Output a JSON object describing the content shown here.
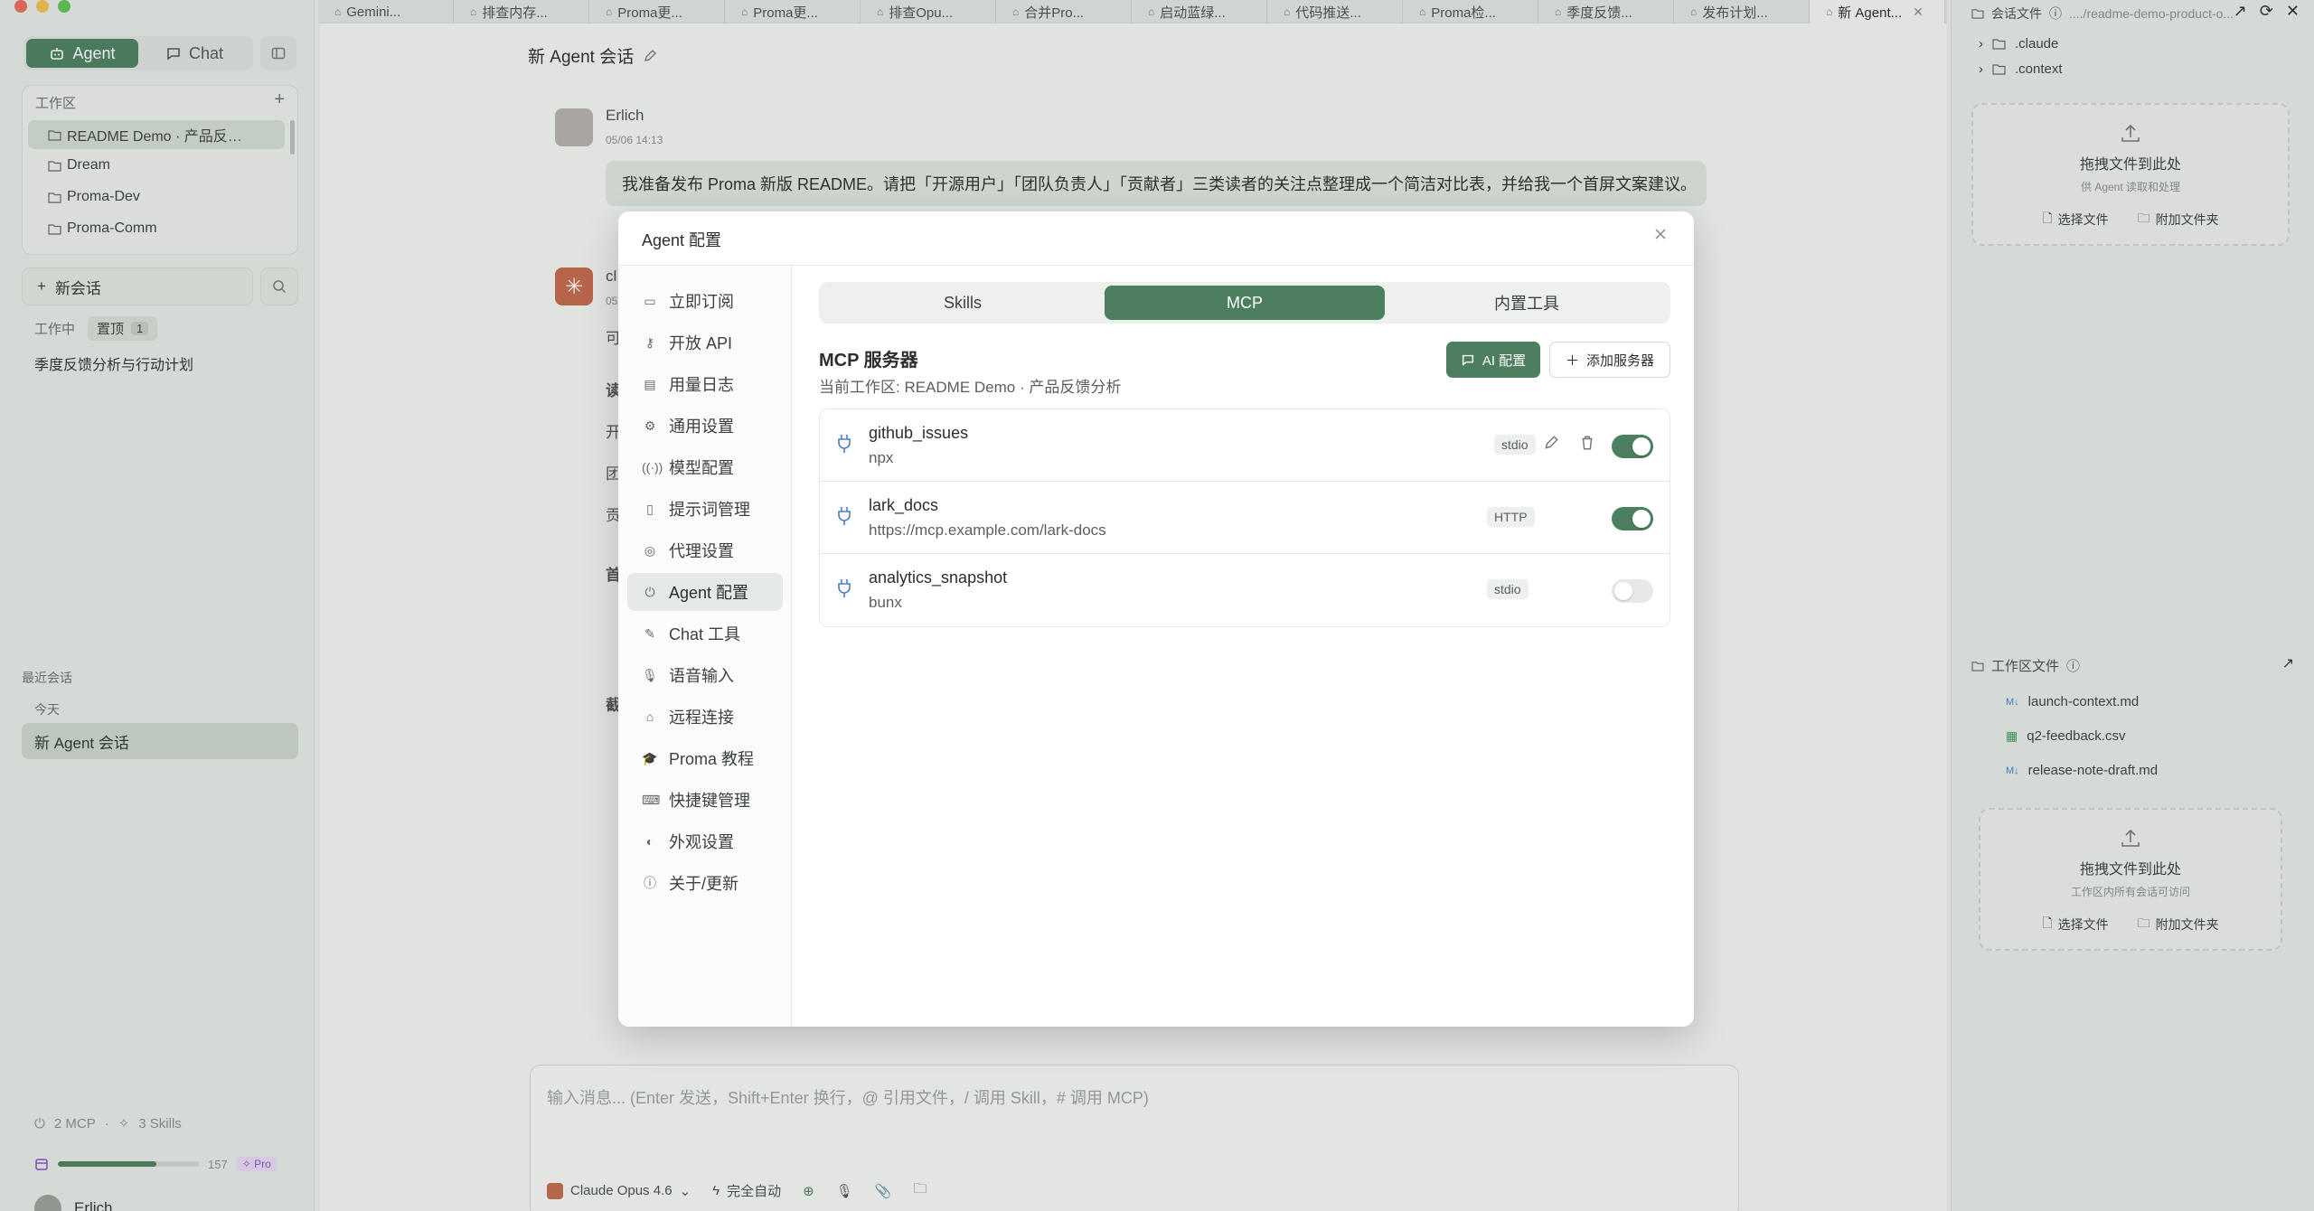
{
  "sidebar": {
    "mode_tabs": {
      "agent": "Agent",
      "chat": "Chat"
    },
    "workspace": {
      "title": "工作区",
      "items": [
        "README Demo · 产品反…",
        "Dream",
        "Proma-Dev",
        "Proma-Comm"
      ]
    },
    "new_chat": "新会话",
    "tags": {
      "working": "工作中",
      "pinned": "置顶",
      "pinned_count": "1"
    },
    "pinned_items": [
      "季度反馈分析与行动计划"
    ],
    "recent_label": "最近会话",
    "today_label": "今天",
    "recent_items": [
      "新 Agent 会话"
    ],
    "stats": {
      "mcp": "2 MCP",
      "skills": "3 Skills"
    },
    "usage": {
      "value": "157",
      "fill_percent": 70,
      "plan": "Pro"
    },
    "user": {
      "name": "Erlich"
    }
  },
  "tabs": [
    {
      "label": "Gemini...",
      "active": false
    },
    {
      "label": "排查内存...",
      "active": false
    },
    {
      "label": "Proma更...",
      "active": false
    },
    {
      "label": "Proma更...",
      "active": false
    },
    {
      "label": "排查Opu...",
      "active": false
    },
    {
      "label": "合并Pro...",
      "active": false
    },
    {
      "label": "启动蓝绿...",
      "active": false
    },
    {
      "label": "代码推送...",
      "active": false
    },
    {
      "label": "Proma检...",
      "active": false
    },
    {
      "label": "季度反馈...",
      "active": false
    },
    {
      "label": "发布计划...",
      "active": false
    },
    {
      "label": "新 Agent...",
      "active": true
    }
  ],
  "chat": {
    "title": "新 Agent 会话",
    "user_name": "Erlich",
    "user_time": "05/06 14:13",
    "user_message": "我准备发布 Proma 新版 README。请把「开源用户」「团队负责人」「贡献者」三类读者的关注点整理成一个简洁对比表，并给我一个首屏文案建议。",
    "ai_name_partial": "cl",
    "ai_time_partial": "05",
    "partial_lines": [
      "可",
      "读",
      "开",
      "团",
      "贡",
      "首",
      "截"
    ],
    "composer_placeholder": "输入消息... (Enter 发送，Shift+Enter 换行，@ 引用文件，/ 调用 Skill，# 调用 MCP)",
    "model": "Claude Opus 4.6",
    "mode": "完全自动"
  },
  "right_panel": {
    "title": "会话文件",
    "path": "..../readme-demo-product-o...",
    "tree": [
      ".claude",
      ".context"
    ],
    "drop1": {
      "title": "拖拽文件到此处",
      "sub": "供 Agent 读取和处理",
      "choose": "选择文件",
      "attach": "附加文件夹"
    },
    "workspace_files_title": "工作区文件",
    "files": [
      {
        "name": "launch-context.md",
        "type": "md"
      },
      {
        "name": "q2-feedback.csv",
        "type": "csv"
      },
      {
        "name": "release-note-draft.md",
        "type": "md"
      }
    ],
    "drop2": {
      "title": "拖拽文件到此处",
      "sub": "工作区内所有会话可访问",
      "choose": "选择文件",
      "attach": "附加文件夹"
    }
  },
  "modal": {
    "title": "Agent 配置",
    "nav": [
      "立即订阅",
      "开放 API",
      "用量日志",
      "通用设置",
      "模型配置",
      "提示词管理",
      "代理设置",
      "Agent 配置",
      "Chat 工具",
      "语音输入",
      "远程连接",
      "Proma 教程",
      "快捷键管理",
      "外观设置",
      "关于/更新"
    ],
    "nav_selected": "Agent 配置",
    "segments": [
      "Skills",
      "MCP",
      "内置工具"
    ],
    "segment_selected": "MCP",
    "section_title": "MCP 服务器",
    "section_sub": "当前工作区: README Demo · 产品反馈分析",
    "ai_config_btn": "AI 配置",
    "add_server_btn": "添加服务器",
    "servers": [
      {
        "name": "github_issues",
        "command": "npx",
        "transport": "stdio",
        "enabled": true,
        "editable": true
      },
      {
        "name": "lark_docs",
        "command": "https://mcp.example.com/lark-docs",
        "transport": "HTTP",
        "enabled": true,
        "editable": false
      },
      {
        "name": "analytics_snapshot",
        "command": "bunx",
        "transport": "stdio",
        "enabled": false,
        "editable": false
      }
    ]
  },
  "colors": {
    "accent": "#4c7f60",
    "sidebar": "#e8ebe8",
    "bubble": "#dfe6df"
  }
}
